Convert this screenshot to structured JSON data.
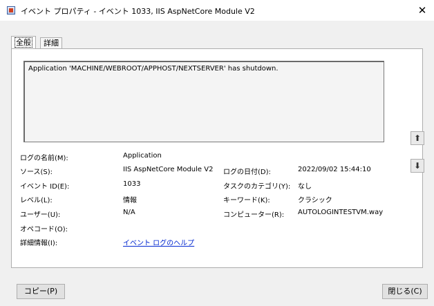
{
  "window": {
    "title": "イベント プロパティ - イベント 1033, IIS AspNetCore Module V2",
    "close_glyph": "✕",
    "icon": "event-viewer-icon"
  },
  "tabs": [
    {
      "label": "全般",
      "selected": true
    },
    {
      "label": "詳細",
      "selected": false
    }
  ],
  "description": "Application 'MACHINE/WEBROOT/APPHOST/NEXTSERVER' has shutdown.",
  "fields": {
    "log_name": {
      "label": "ログの名前(M):",
      "value": "Application"
    },
    "source": {
      "label": "ソース(S):",
      "value": "IIS AspNetCore Module V2"
    },
    "logged": {
      "label": "ログの日付(D):",
      "value": "2022/09/02 15:44:10"
    },
    "event_id": {
      "label": "イベント ID(E):",
      "value": "1033"
    },
    "task_category": {
      "label": "タスクのカテゴリ(Y):",
      "value": "なし"
    },
    "level": {
      "label": "レベル(L):",
      "value": "情報"
    },
    "keywords": {
      "label": "キーワード(K):",
      "value": "クラシック"
    },
    "user": {
      "label": "ユーザー(U):",
      "value": "N/A"
    },
    "computer": {
      "label": "コンピューター(R):",
      "value": "AUTOLOGINTESTVM.way"
    },
    "opcode": {
      "label": "オペコード(O):",
      "value": ""
    },
    "more_info": {
      "label": "詳細情報(I):",
      "value": "イベント ログのヘルプ"
    }
  },
  "nav": {
    "up_icon": "up-arrow-icon",
    "down_icon": "down-arrow-icon",
    "up_glyph": "⬆",
    "down_glyph": "⬇"
  },
  "buttons": {
    "copy": "コピー(P)",
    "close": "閉じる(C)"
  }
}
